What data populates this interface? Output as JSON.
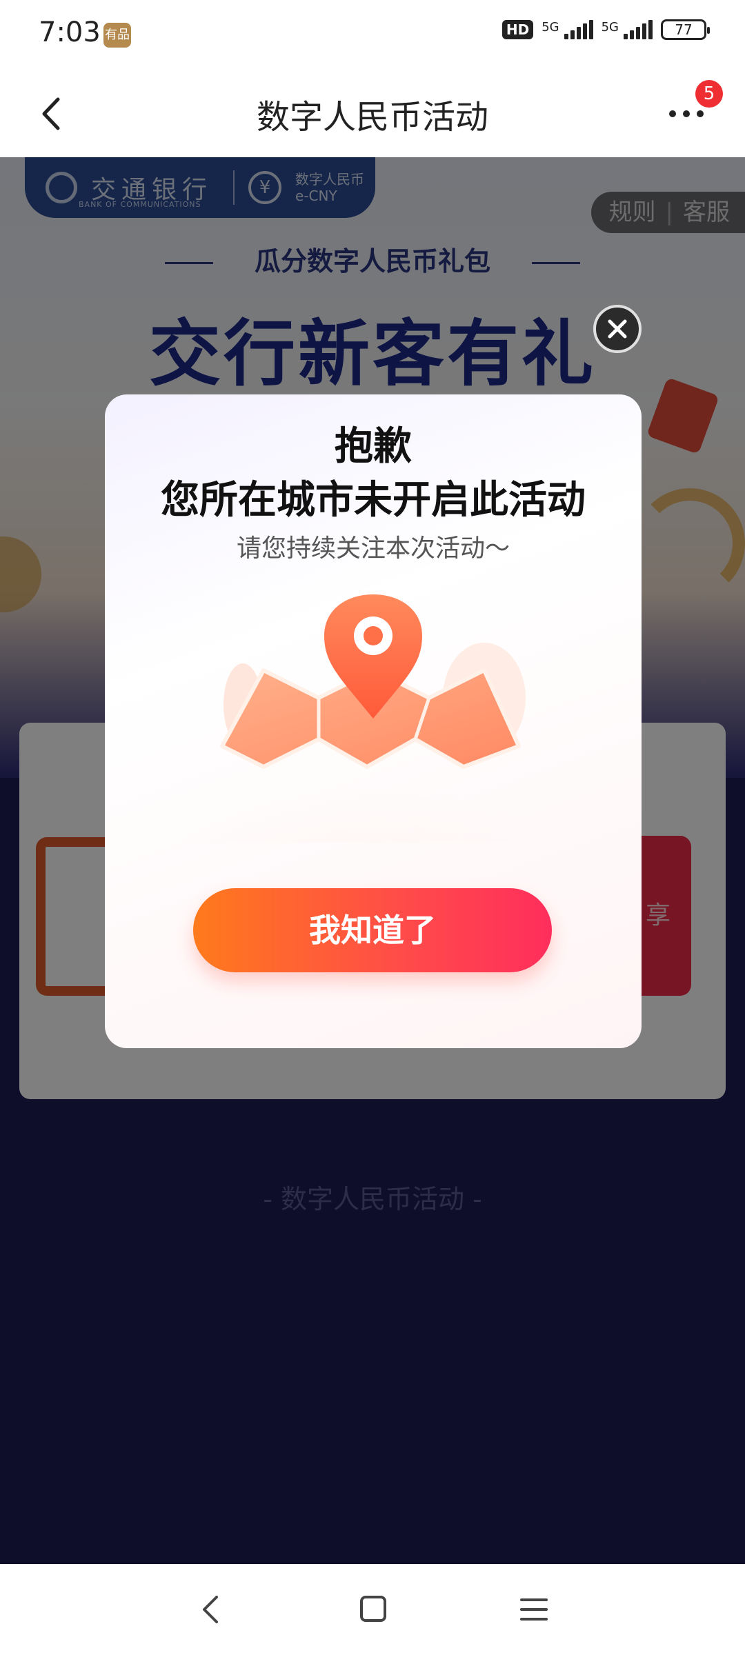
{
  "status_bar": {
    "time": "7:03",
    "app_badge": "有品",
    "hd_label": "HD",
    "network_1": "5G",
    "network_2": "5G",
    "battery": "77"
  },
  "nav": {
    "title": "数字人民币活动",
    "notification_count": "5"
  },
  "background": {
    "bank_name": "交通银行",
    "bank_name_en": "BANK OF COMMUNICATIONS",
    "ecny_label": "数字人民币",
    "ecny_sub": "e-CNY",
    "rules_link": "规则",
    "service_link": "客服",
    "sub_banner": "瓜分数字人民币礼包",
    "hero_title": "交行新客有礼",
    "card_right_text": "享",
    "footer_text": "- 数字人民币活动 -"
  },
  "modal": {
    "title": "抱歉",
    "subtitle": "您所在城市未开启此活动",
    "hint": "请您持续关注本次活动～",
    "confirm_label": "我知道了"
  },
  "icons": {
    "back": "chevron-left-icon",
    "more": "more-dots-icon",
    "close": "close-icon",
    "illustration": "map-pin-icon",
    "sys_back": "triangle-back-icon",
    "sys_home": "square-home-icon",
    "sys_menu": "menu-lines-icon"
  },
  "colors": {
    "accent_start": "#ff7a1c",
    "accent_end": "#ff2e5c",
    "badge_red": "#ee2e33",
    "page_bg": "#1e1d55"
  }
}
